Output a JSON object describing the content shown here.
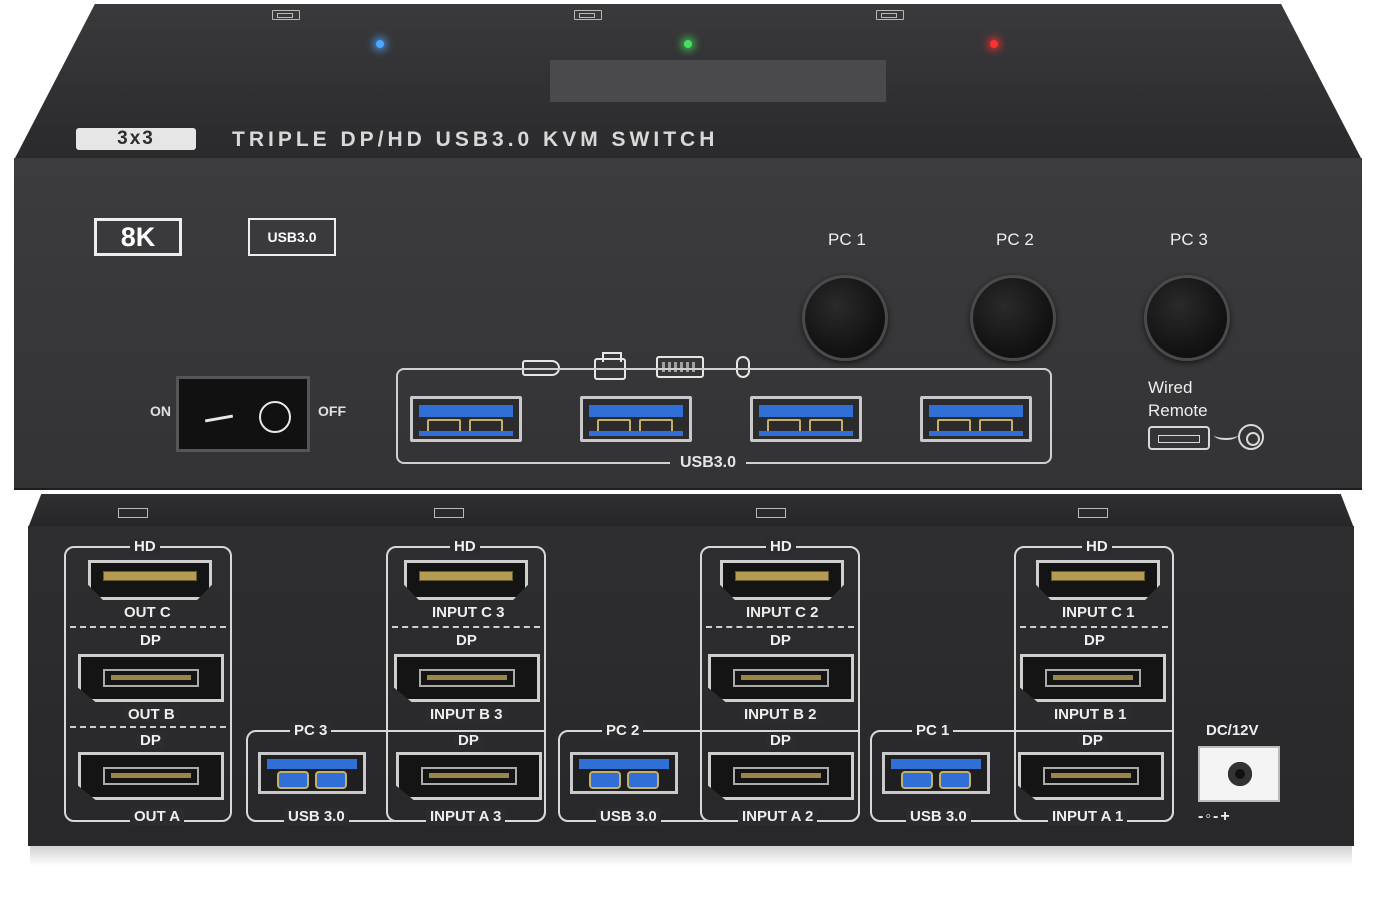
{
  "top_unit": {
    "badge_3x3": "3x3",
    "title": "TRIPLE DP/HD USB3.0 KVM SWITCH",
    "badge_8k": "8K",
    "badge_usb": "USB3.0",
    "pc_buttons": [
      "PC 1",
      "PC 2",
      "PC 3"
    ],
    "power_on": "ON",
    "power_off": "OFF",
    "usb_hub_label": "USB3.0",
    "wired_remote_line1": "Wired",
    "wired_remote_line2": "Remote",
    "led_colors": [
      "#4aa8ff",
      "#44e05c",
      "#ff3030"
    ]
  },
  "bottom_unit": {
    "hd_label": "HD",
    "dp_label": "DP",
    "out_group": {
      "c": "OUT C",
      "b": "OUT B",
      "a": "OUT A"
    },
    "pc_groups": [
      {
        "pc": "PC 3",
        "usb": "USB 3.0",
        "c": "INPUT C 3",
        "b": "INPUT B 3",
        "a": "INPUT A 3"
      },
      {
        "pc": "PC 2",
        "usb": "USB 3.0",
        "c": "INPUT C 2",
        "b": "INPUT B 2",
        "a": "INPUT A 2"
      },
      {
        "pc": "PC 1",
        "usb": "USB 3.0",
        "c": "INPUT C 1",
        "b": "INPUT B 1",
        "a": "INPUT A 1"
      }
    ],
    "dc_label": "DC/12V",
    "dc_polarity": "-◦-+"
  }
}
